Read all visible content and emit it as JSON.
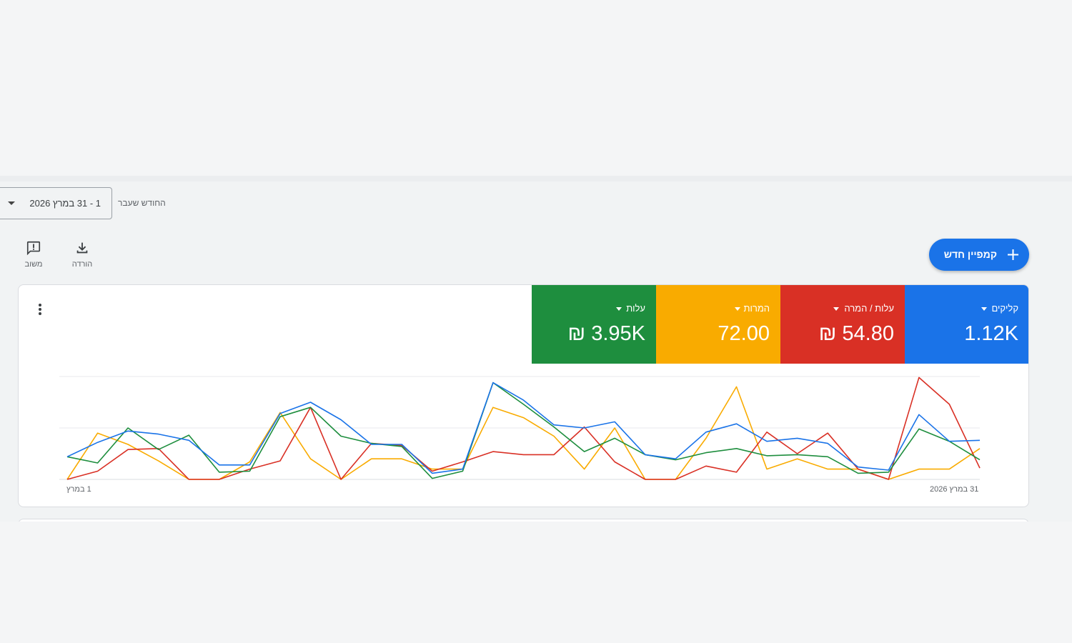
{
  "toolbar": {
    "date_range": "1 - 31 במרץ 2026",
    "period_label": "החודש שעבר",
    "feedback_label": "משוב",
    "download_label": "הורדה",
    "new_campaign_label": "קמפיין חדש"
  },
  "metrics": [
    {
      "label": "קליקים",
      "value": "1.12K",
      "color": "#1a73e8"
    },
    {
      "label": "עלות / המרה",
      "value": "₪ 54.80",
      "color": "#d93025"
    },
    {
      "label": "המרות",
      "value": "72.00",
      "color": "#f9ab00"
    },
    {
      "label": "עלות",
      "value": "₪ 3.95K",
      "color": "#1e8e3e"
    }
  ],
  "chart_data": {
    "type": "line",
    "x_start_label": "1 במרץ",
    "x_end_label": "31 במרץ 2026",
    "y_scale": "each series normalized to its own range (0-100)",
    "grid": true,
    "series": [
      {
        "name": "קליקים",
        "color": "#1a73e8",
        "values": [
          22,
          36,
          47,
          44,
          38,
          14,
          14,
          64,
          75,
          58,
          34,
          34,
          6,
          10,
          94,
          77,
          53,
          50,
          56,
          24,
          20,
          46,
          54,
          37,
          40,
          35,
          12,
          9,
          63,
          37,
          38
        ]
      },
      {
        "name": "עלות / המרה",
        "color": "#d93025",
        "values": [
          0,
          8,
          29,
          30,
          0,
          0,
          10,
          18,
          70,
          0,
          35,
          33,
          8,
          17,
          27,
          24,
          24,
          51,
          17,
          0,
          0,
          13,
          7,
          46,
          25,
          45,
          10,
          0,
          99,
          73,
          11
        ]
      },
      {
        "name": "המרות",
        "color": "#f9ab00",
        "values": [
          0,
          45,
          34,
          18,
          0,
          0,
          17,
          65,
          20,
          0,
          20,
          20,
          10,
          10,
          70,
          60,
          42,
          10,
          50,
          0,
          0,
          40,
          90,
          10,
          20,
          10,
          10,
          0,
          10,
          10,
          30
        ]
      },
      {
        "name": "עלות",
        "color": "#1e8e3e",
        "values": [
          22,
          16,
          50,
          29,
          43,
          7,
          8,
          61,
          70,
          42,
          35,
          32,
          1,
          8,
          94,
          73,
          51,
          27,
          40,
          24,
          19,
          26,
          30,
          23,
          24,
          22,
          6,
          7,
          49,
          37,
          19
        ]
      }
    ]
  }
}
